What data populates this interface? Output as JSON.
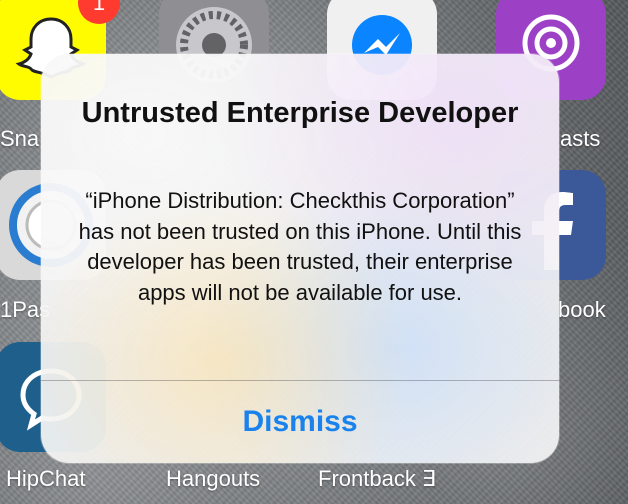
{
  "home_screen": {
    "apps": [
      {
        "label": "Sna",
        "icon": "snapchat-icon",
        "color": "#fffc00"
      },
      {
        "label": "",
        "icon": "settings-icon",
        "color": "#8e8e93"
      },
      {
        "label": "",
        "icon": "messenger-icon",
        "color": "#f0f0f0"
      },
      {
        "label": "asts",
        "icon": "podcasts-icon",
        "color": "#9c40c6"
      },
      {
        "label": "1Pas",
        "icon": "onepassword-icon",
        "color": "#d9d9d9"
      },
      {
        "label": "book",
        "icon": "facebook-icon",
        "color": "#3b5998"
      },
      {
        "label": "HipChat",
        "icon": "hipchat-icon",
        "color": "#1e5f8c"
      },
      {
        "label": "Hangouts",
        "icon": "hangouts-icon",
        "color": "#0f9d58"
      },
      {
        "label": "Frontback ∃",
        "icon": "frontback-icon",
        "color": "#333333"
      }
    ],
    "snapchat_badge": "1"
  },
  "alert": {
    "title": "Untrusted Enterprise Developer",
    "message": "“iPhone Distribution: Checkthis Corporation” has not been trusted on this iPhone. Until this developer has been trusted, their enterprise apps will not be available for use.",
    "dismiss_label": "Dismiss",
    "button_color": "#1a82ec"
  }
}
